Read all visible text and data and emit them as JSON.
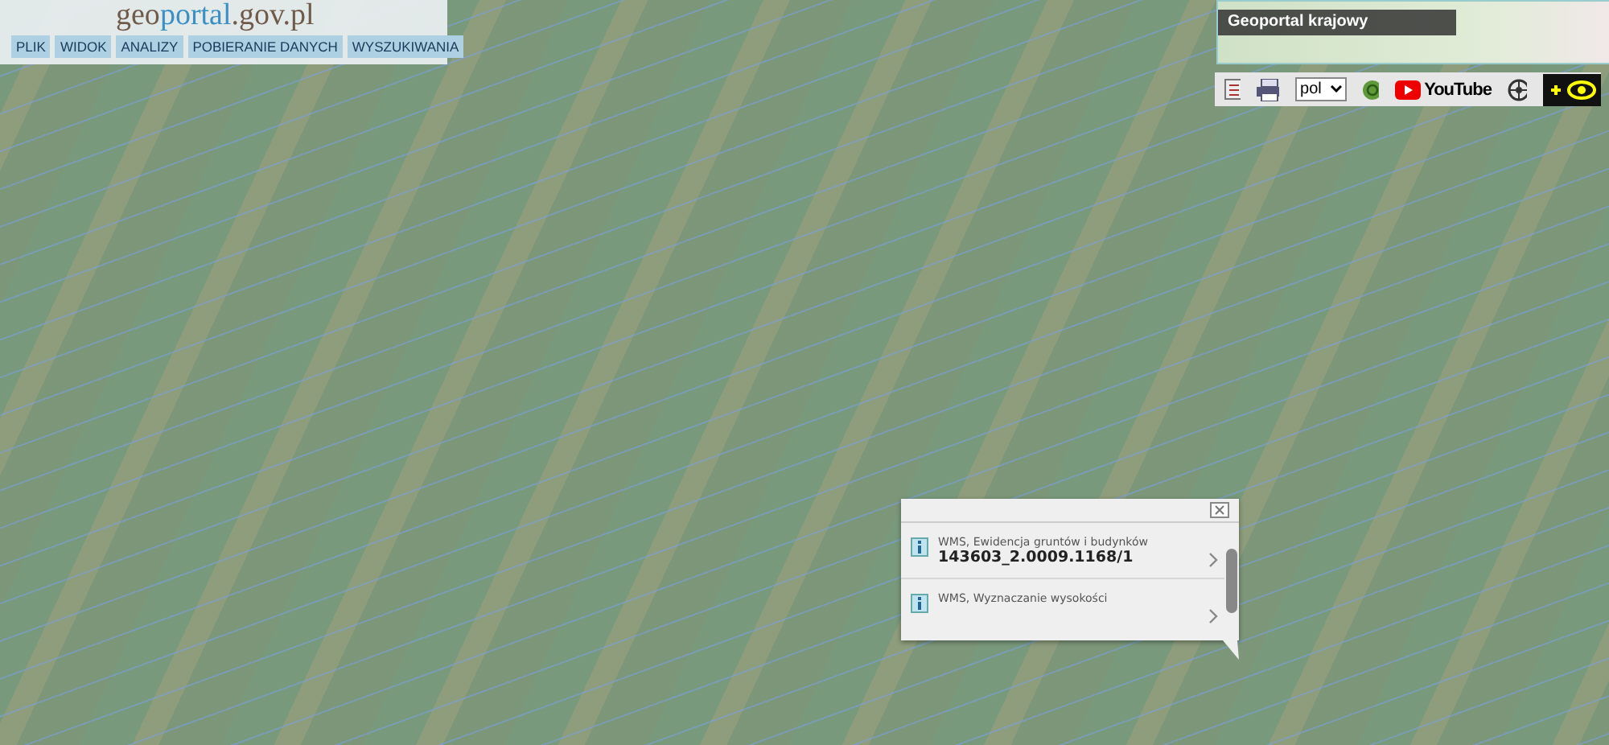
{
  "logo": {
    "prefix": "geo",
    "highlight": "portal",
    "suffix": ".gov.pl"
  },
  "menu": [
    {
      "label": "PLIK"
    },
    {
      "label": "WIDOK"
    },
    {
      "label": "ANALIZY"
    },
    {
      "label": "POBIERANIE DANYCH"
    },
    {
      "label": "WYSZUKIWANIA"
    }
  ],
  "overview_map": {
    "title": "Geoportal krajowy"
  },
  "toolbar": {
    "language": "pol",
    "youtube": "YouTube"
  },
  "info_popup": {
    "items": [
      {
        "layer": "WMS, Ewidencja gruntów i budynków",
        "value": "143603_2.0009.1168/1"
      },
      {
        "layer": "WMS, Wyznaczanie wysokości"
      }
    ]
  }
}
